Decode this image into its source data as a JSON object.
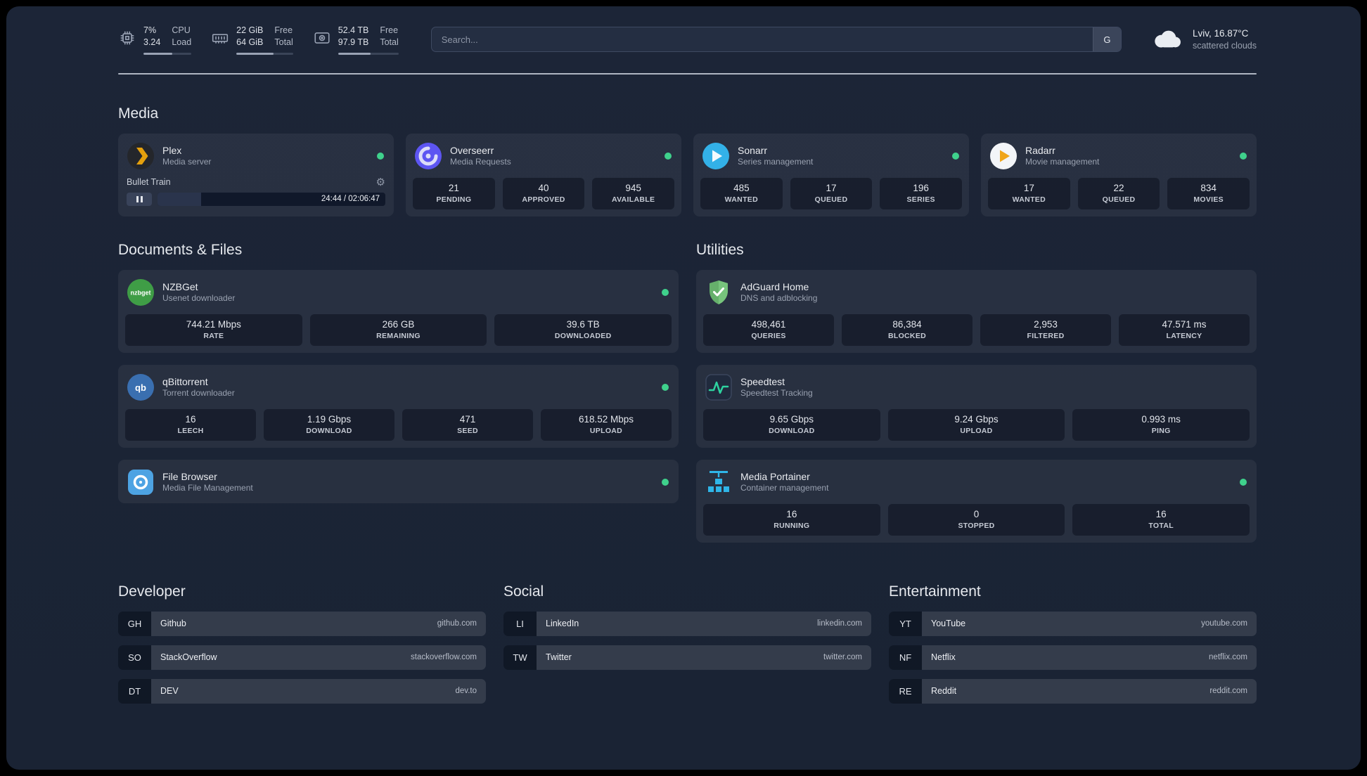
{
  "topbar": {
    "cpu": {
      "v1": "7%",
      "l1": "CPU",
      "v2": "3.24",
      "l2": "Load",
      "bar_pct": 60
    },
    "memory": {
      "v1": "22 GiB",
      "l1": "Free",
      "v2": "64 GiB",
      "l2": "Total",
      "bar_pct": 66
    },
    "disk": {
      "v1": "52.4 TB",
      "l1": "Free",
      "v2": "97.9 TB",
      "l2": "Total",
      "bar_pct": 54
    },
    "search": {
      "placeholder": "Search...",
      "button_label": "G"
    },
    "weather": {
      "location": "Lviv, 16.87°C",
      "condition": "scattered clouds"
    }
  },
  "groups": {
    "media": {
      "title": "Media",
      "plex": {
        "name": "Plex",
        "desc": "Media server",
        "status": "online",
        "player": {
          "track": "Bullet Train",
          "time": "24:44 / 02:06:47",
          "progress_pct": 19
        }
      },
      "overseerr": {
        "name": "Overseerr",
        "desc": "Media Requests",
        "status": "online",
        "stats": [
          {
            "v": "21",
            "l": "PENDING"
          },
          {
            "v": "40",
            "l": "APPROVED"
          },
          {
            "v": "945",
            "l": "AVAILABLE"
          }
        ]
      },
      "sonarr": {
        "name": "Sonarr",
        "desc": "Series management",
        "status": "online",
        "stats": [
          {
            "v": "485",
            "l": "WANTED"
          },
          {
            "v": "17",
            "l": "QUEUED"
          },
          {
            "v": "196",
            "l": "SERIES"
          }
        ]
      },
      "radarr": {
        "name": "Radarr",
        "desc": "Movie management",
        "status": "online",
        "stats": [
          {
            "v": "17",
            "l": "WANTED"
          },
          {
            "v": "22",
            "l": "QUEUED"
          },
          {
            "v": "834",
            "l": "MOVIES"
          }
        ]
      }
    },
    "documents": {
      "title": "Documents & Files",
      "nzbget": {
        "name": "NZBGet",
        "desc": "Usenet downloader",
        "status": "online",
        "stats": [
          {
            "v": "744.21 Mbps",
            "l": "RATE"
          },
          {
            "v": "266 GB",
            "l": "REMAINING"
          },
          {
            "v": "39.6 TB",
            "l": "DOWNLOADED"
          }
        ]
      },
      "qbittorrent": {
        "name": "qBittorrent",
        "desc": "Torrent downloader",
        "status": "online",
        "stats": [
          {
            "v": "16",
            "l": "LEECH"
          },
          {
            "v": "1.19 Gbps",
            "l": "DOWNLOAD"
          },
          {
            "v": "471",
            "l": "SEED"
          },
          {
            "v": "618.52 Mbps",
            "l": "UPLOAD"
          }
        ]
      },
      "filebrowser": {
        "name": "File Browser",
        "desc": "Media File Management",
        "status": "online"
      }
    },
    "utilities": {
      "title": "Utilities",
      "adguard": {
        "name": "AdGuard Home",
        "desc": "DNS and adblocking",
        "stats": [
          {
            "v": "498,461",
            "l": "QUERIES"
          },
          {
            "v": "86,384",
            "l": "BLOCKED"
          },
          {
            "v": "2,953",
            "l": "FILTERED"
          },
          {
            "v": "47.571 ms",
            "l": "LATENCY"
          }
        ]
      },
      "speedtest": {
        "name": "Speedtest",
        "desc": "Speedtest Tracking",
        "stats": [
          {
            "v": "9.65 Gbps",
            "l": "DOWNLOAD"
          },
          {
            "v": "9.24 Gbps",
            "l": "UPLOAD"
          },
          {
            "v": "0.993 ms",
            "l": "PING"
          }
        ]
      },
      "portainer": {
        "name": "Media Portainer",
        "desc": "Container management",
        "status": "online",
        "stats": [
          {
            "v": "16",
            "l": "RUNNING"
          },
          {
            "v": "0",
            "l": "STOPPED"
          },
          {
            "v": "16",
            "l": "TOTAL"
          }
        ]
      }
    }
  },
  "bookmarks": {
    "developer": {
      "title": "Developer",
      "items": [
        {
          "abbr": "GH",
          "name": "Github",
          "url": "github.com"
        },
        {
          "abbr": "SO",
          "name": "StackOverflow",
          "url": "stackoverflow.com"
        },
        {
          "abbr": "DT",
          "name": "DEV",
          "url": "dev.to"
        }
      ]
    },
    "social": {
      "title": "Social",
      "items": [
        {
          "abbr": "LI",
          "name": "LinkedIn",
          "url": "linkedin.com"
        },
        {
          "abbr": "TW",
          "name": "Twitter",
          "url": "twitter.com"
        }
      ]
    },
    "entertainment": {
      "title": "Entertainment",
      "items": [
        {
          "abbr": "YT",
          "name": "YouTube",
          "url": "youtube.com"
        },
        {
          "abbr": "NF",
          "name": "Netflix",
          "url": "netflix.com"
        },
        {
          "abbr": "RE",
          "name": "Reddit",
          "url": "reddit.com"
        }
      ]
    }
  },
  "colors": {
    "status_online": "#3fd18c",
    "accent_green": "#2ed3a0",
    "plex_amber": "#e5a00d",
    "overseerr_purple": "#5d55f2",
    "sonarr_blue": "#33b1e8",
    "radarr_amber": "#f0a519",
    "nzbget_green": "#3f9d46",
    "qbittorrent_blue": "#3a6fb0",
    "filebrowser_blue": "#4da3e3",
    "adguard_green": "#66b06b",
    "portainer_blue": "#2fb5e8"
  },
  "icons": {
    "cpu-icon": "chip-outline",
    "memory-icon": "ram-outline",
    "disk-icon": "drive-outline",
    "cloud-icon": "cloud",
    "gear-icon": "⚙",
    "pause-icon": "❚❚",
    "status-dot": "●"
  }
}
